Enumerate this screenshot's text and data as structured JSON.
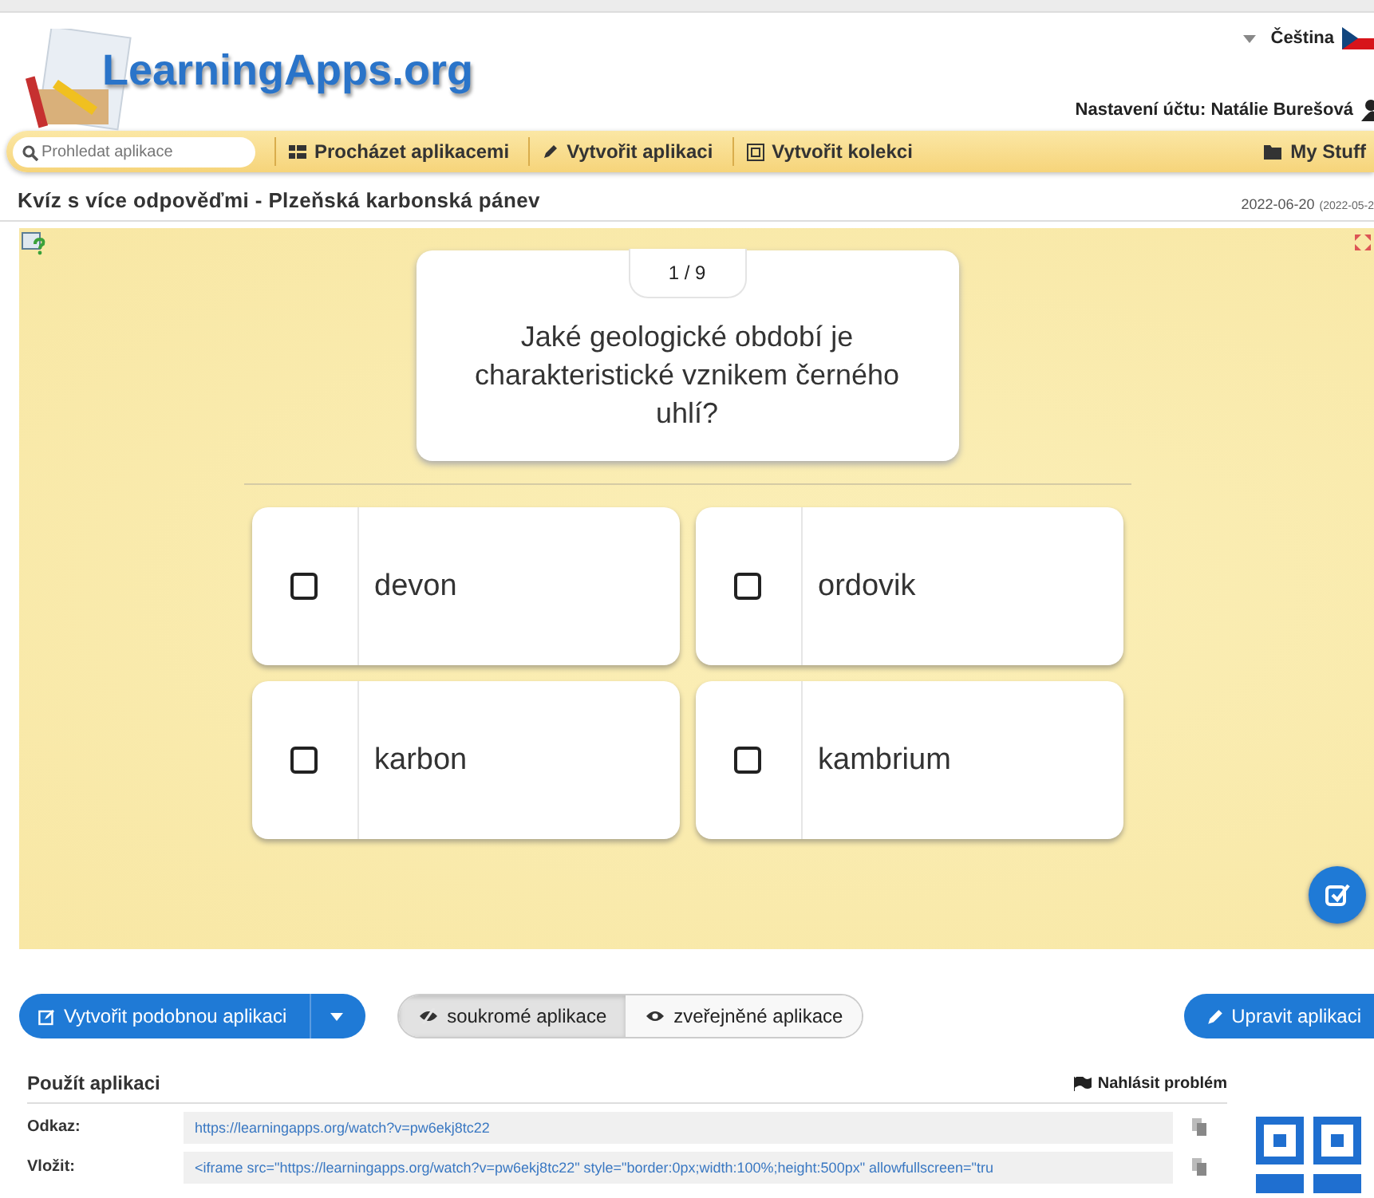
{
  "header": {
    "logo": "LearningApps.org",
    "language": "Čeština",
    "account": "Nastavení účtu: Natálie Burešová"
  },
  "nav": {
    "search": {
      "placeholder": "Prohledat aplikace"
    },
    "links": [
      "Procházet aplikacemi",
      "Vytvořit aplikaci",
      "Vytvořit kolekci"
    ],
    "my_stuff": "My Stuff"
  },
  "app": {
    "title": "Kvíz s více odpověďmi - Plzeňská karbonská pánev",
    "date": "2022-06-20",
    "date_created": "(2022-05-2"
  },
  "quiz": {
    "counter": "1 / 9",
    "question": "Jaké geologické období je charakteristické vznikem černého uhlí?",
    "answers": [
      {
        "text": "devon",
        "checked": false
      },
      {
        "text": "ordovik",
        "checked": false
      },
      {
        "text": "karbon",
        "checked": false
      },
      {
        "text": "kambrium",
        "checked": false
      }
    ]
  },
  "actions": {
    "create_similar": "Vytvořit podobnou aplikaci",
    "visibility": [
      {
        "label": "soukromé aplikace",
        "selected": true
      },
      {
        "label": "zveřejněné aplikace",
        "selected": false
      }
    ],
    "edit": "Upravit aplikaci"
  },
  "use": {
    "heading": "Použít aplikaci",
    "report": "Nahlásit problém",
    "rows": [
      {
        "label": "Odkaz:",
        "value": "https://learningapps.org/watch?v=pw6ekj8tc22"
      },
      {
        "label": "Vložit:",
        "value": "<iframe src=\"https://learningapps.org/watch?v=pw6ekj8tc22\" style=\"border:0px;width:100%;height:500px\" allowfullscreen=\"tru"
      }
    ]
  }
}
